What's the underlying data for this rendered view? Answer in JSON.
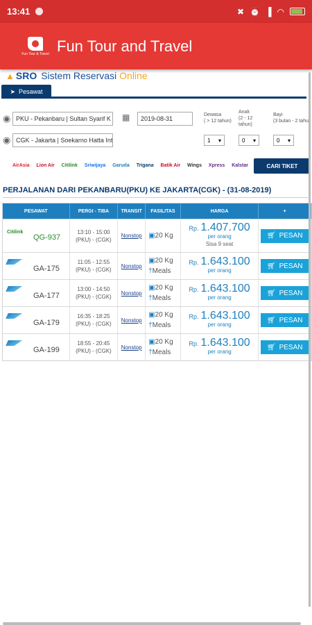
{
  "status_bar": {
    "time": "13:41"
  },
  "app_bar": {
    "title": "Fun Tour and Travel",
    "logo_text": "Fun Tour & Travel"
  },
  "sro": {
    "abbr": "SRO",
    "name1": "Sistem Reservasi",
    "name2": "Online"
  },
  "tab": {
    "label": "Pesawat"
  },
  "search": {
    "from": "PKU - Pekanbaru | Sultan Syarif K",
    "to": "CGK - Jakarta | Soekarno Hatta Int",
    "date": "2019-08-31",
    "adult_label": "Dewasa\n( > 12 tahun)",
    "child_label": "Anak\n(2 - 12\ntahun)",
    "infant_label": "Bayi\n(3 bulan - 2 tahu",
    "adult_value": "1",
    "child_value": "0",
    "infant_value": "0",
    "search_button": "CARI TIKET"
  },
  "airlines": [
    "AirAsia",
    "Lion Air",
    "Citilink",
    "Sriwijaya",
    "Garuda",
    "Trigana",
    "Batik Air",
    "Wings",
    "Xpress",
    "Kalstar"
  ],
  "route_title": "PERJALANAN DARI PEKANBARU(PKU) KE JAKARTA(CGK) - (31-08-2019)",
  "table": {
    "headers": [
      "PESAWAT",
      "PERGI - TIBA",
      "TRANSIT",
      "FASILITAS",
      "HARGA",
      "+"
    ],
    "rows": [
      {
        "airline": "Citilink",
        "flight": "QG-937",
        "time": "13:10 - 15:00",
        "route": "(PKU) - (CGK)",
        "transit": "Nonstop",
        "baggage": "20 Kg",
        "meals": "",
        "rp": "Rp.",
        "price": "1.407.700",
        "per": "per orang",
        "sisa": "Sisa 9 seat",
        "book": "PESAN"
      },
      {
        "airline": "Garuda",
        "flight": "GA-175",
        "time": "11:05 - 12:55",
        "route": "(PKU) - (CGK)",
        "transit": "Nonstop",
        "baggage": "20 Kg",
        "meals": "Meals",
        "rp": "Rp.",
        "price": "1.643.100",
        "per": "per orang",
        "sisa": "",
        "book": "PESAN"
      },
      {
        "airline": "Garuda",
        "flight": "GA-177",
        "time": "13:00 - 14:50",
        "route": "(PKU) - (CGK)",
        "transit": "Nonstop",
        "baggage": "20 Kg",
        "meals": "Meals",
        "rp": "Rp.",
        "price": "1.643.100",
        "per": "per orang",
        "sisa": "",
        "book": "PESAN"
      },
      {
        "airline": "Garuda",
        "flight": "GA-179",
        "time": "16:35 - 18:25",
        "route": "(PKU) - (CGK)",
        "transit": "Nonstop",
        "baggage": "20 Kg",
        "meals": "Meals",
        "rp": "Rp.",
        "price": "1.643.100",
        "per": "per orang",
        "sisa": "",
        "book": "PESAN"
      },
      {
        "airline": "Garuda",
        "flight": "GA-199",
        "time": "18:55 - 20:45",
        "route": "(PKU) - (CGK)",
        "transit": "Nonstop",
        "baggage": "20 Kg",
        "meals": "Meals",
        "rp": "Rp.",
        "price": "1.643.100",
        "per": "per orang",
        "sisa": "",
        "book": "PESAN"
      }
    ]
  },
  "colors": {
    "app_bar": "#e53935",
    "status_bar": "#d32f2f",
    "nav": "#0b3a6e",
    "table_head": "#1e7fbf",
    "book_button": "#1aa3d9"
  }
}
